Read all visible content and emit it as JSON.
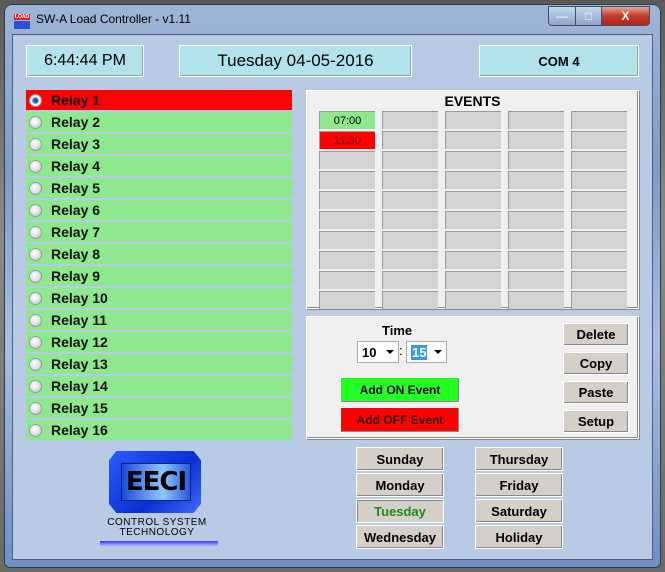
{
  "window": {
    "title": "SW-A Load Controller - v1.11",
    "icon_top_text": "LOAD",
    "controls": {
      "minimize": "—",
      "maximize": "□",
      "close": "X"
    }
  },
  "header": {
    "clock": "6:44:44 PM",
    "date": "Tuesday 04-05-2016",
    "com_port": "COM 4"
  },
  "relays": [
    {
      "label": "Relay 1",
      "selected": true,
      "state": "on"
    },
    {
      "label": "Relay 2"
    },
    {
      "label": "Relay 3"
    },
    {
      "label": "Relay 4"
    },
    {
      "label": "Relay 5"
    },
    {
      "label": "Relay 6"
    },
    {
      "label": "Relay 7"
    },
    {
      "label": "Relay 8"
    },
    {
      "label": "Relay 9"
    },
    {
      "label": "Relay 10"
    },
    {
      "label": "Relay 11"
    },
    {
      "label": "Relay 12"
    },
    {
      "label": "Relay 13"
    },
    {
      "label": "Relay 14"
    },
    {
      "label": "Relay 15"
    },
    {
      "label": "Relay 16"
    }
  ],
  "events": {
    "title": "EVENTS",
    "columns": 5,
    "rows": 10,
    "entries": [
      {
        "col": 0,
        "row": 0,
        "time": "07:00",
        "type": "on"
      },
      {
        "col": 0,
        "row": 1,
        "time": "11:30",
        "type": "off"
      }
    ]
  },
  "controls": {
    "time_label": "Time",
    "hour": "10",
    "minute": "15",
    "separator": ":",
    "add_on_label": "Add ON Event",
    "add_off_label": "Add OFF Event",
    "delete_label": "Delete",
    "copy_label": "Copy",
    "paste_label": "Paste",
    "setup_label": "Setup"
  },
  "days": [
    {
      "label": "Sunday"
    },
    {
      "label": "Monday"
    },
    {
      "label": "Tuesday",
      "active": true
    },
    {
      "label": "Wednesday"
    },
    {
      "label": "Thursday"
    },
    {
      "label": "Friday"
    },
    {
      "label": "Saturday"
    },
    {
      "label": "Holiday"
    }
  ],
  "logo": {
    "name": "EECI",
    "line1": "CONTROL SYSTEM",
    "line2": "TECHNOLOGY"
  },
  "colors": {
    "relay_off": "#8ee88e",
    "relay_on": "#ff0000",
    "event_on": "#8ee88e",
    "event_off": "#ff0000",
    "active_day_text": "#1a8a1a"
  }
}
